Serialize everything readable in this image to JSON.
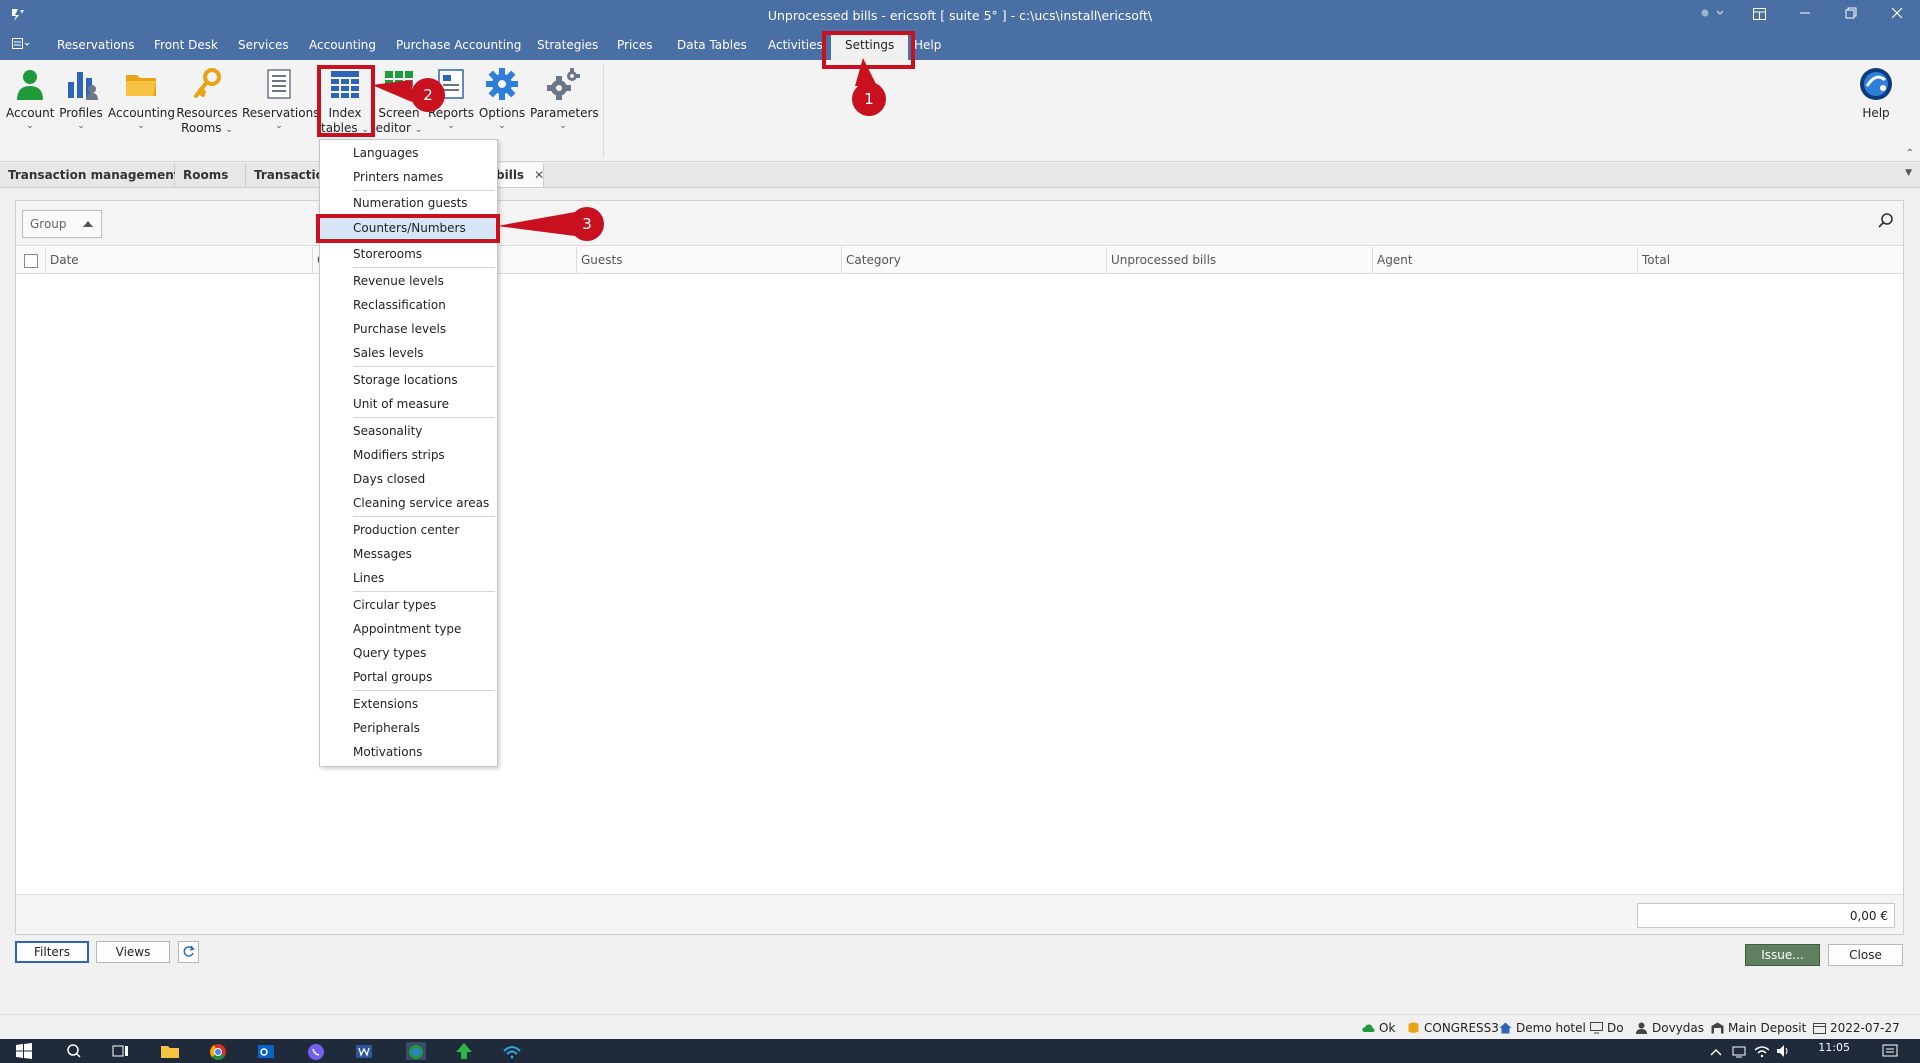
{
  "window": {
    "title": "Unprocessed bills - ericsoft [ suite 5° ] - c:\\ucs\\install\\ericsoft\\"
  },
  "menu": {
    "items": [
      "Reservations",
      "Front Desk",
      "Services",
      "Accounting",
      "Purchase Accounting",
      "Strategies",
      "Prices",
      "Data Tables",
      "Activities",
      "Settings",
      "Help"
    ],
    "active": "Settings"
  },
  "ribbon": {
    "account": "Account",
    "profiles": "Profiles",
    "accounting": "Accounting",
    "resources_1": "Resources",
    "resources_2": "Rooms",
    "reservations": "Reservations",
    "index_1": "Index",
    "index_2": "tables",
    "screen_1": "Screen",
    "screen_2": "editor",
    "reports": "Reports",
    "options": "Options",
    "parameters": "Parameters",
    "help": "Help"
  },
  "tabs": {
    "t1": "Transaction management",
    "t2": "Rooms",
    "t3": "Transaction m",
    "t4": "bills"
  },
  "index_menu": {
    "items": [
      "Languages",
      "Printers names",
      "Numeration guests",
      "Counters/Numbers",
      "Storerooms",
      "Revenue levels",
      "Reclassification",
      "Purchase levels",
      "Sales levels",
      "Storage locations",
      "Unit of measure",
      "Seasonality",
      "Modifiers strips",
      "Days closed",
      "Cleaning service areas",
      "Production center",
      "Messages",
      "Lines",
      "Circular types",
      "Appointment type",
      "Query types",
      "Portal groups",
      "Extensions",
      "Peripherals",
      "Motivations"
    ],
    "highlighted": "Counters/Numbers"
  },
  "grid": {
    "group_placeholder": "Group",
    "columns": [
      "Date",
      "G",
      "Guests",
      "Category",
      "Unprocessed bills",
      "Agent",
      "Total"
    ],
    "total": "0,00 €"
  },
  "buttons": {
    "filters": "Filters",
    "views": "Views",
    "issue": "Issue...",
    "close": "Close"
  },
  "status": {
    "ok": "Ok",
    "db": "CONGRESS3",
    "hotel": "Demo hotel",
    "pc": "Do",
    "user": "Dovydas",
    "deposit": "Main Deposit",
    "date": "2022-07-27"
  },
  "taskbar": {
    "time": "11:05"
  },
  "annotations": {
    "a1": "1",
    "a2": "2",
    "a3": "3"
  },
  "colors": {
    "title_bar": "#4a6fa5",
    "annotation_red": "#c8101e",
    "highlight": "#d6e6f7",
    "issue_button": "#5f7f5f"
  }
}
